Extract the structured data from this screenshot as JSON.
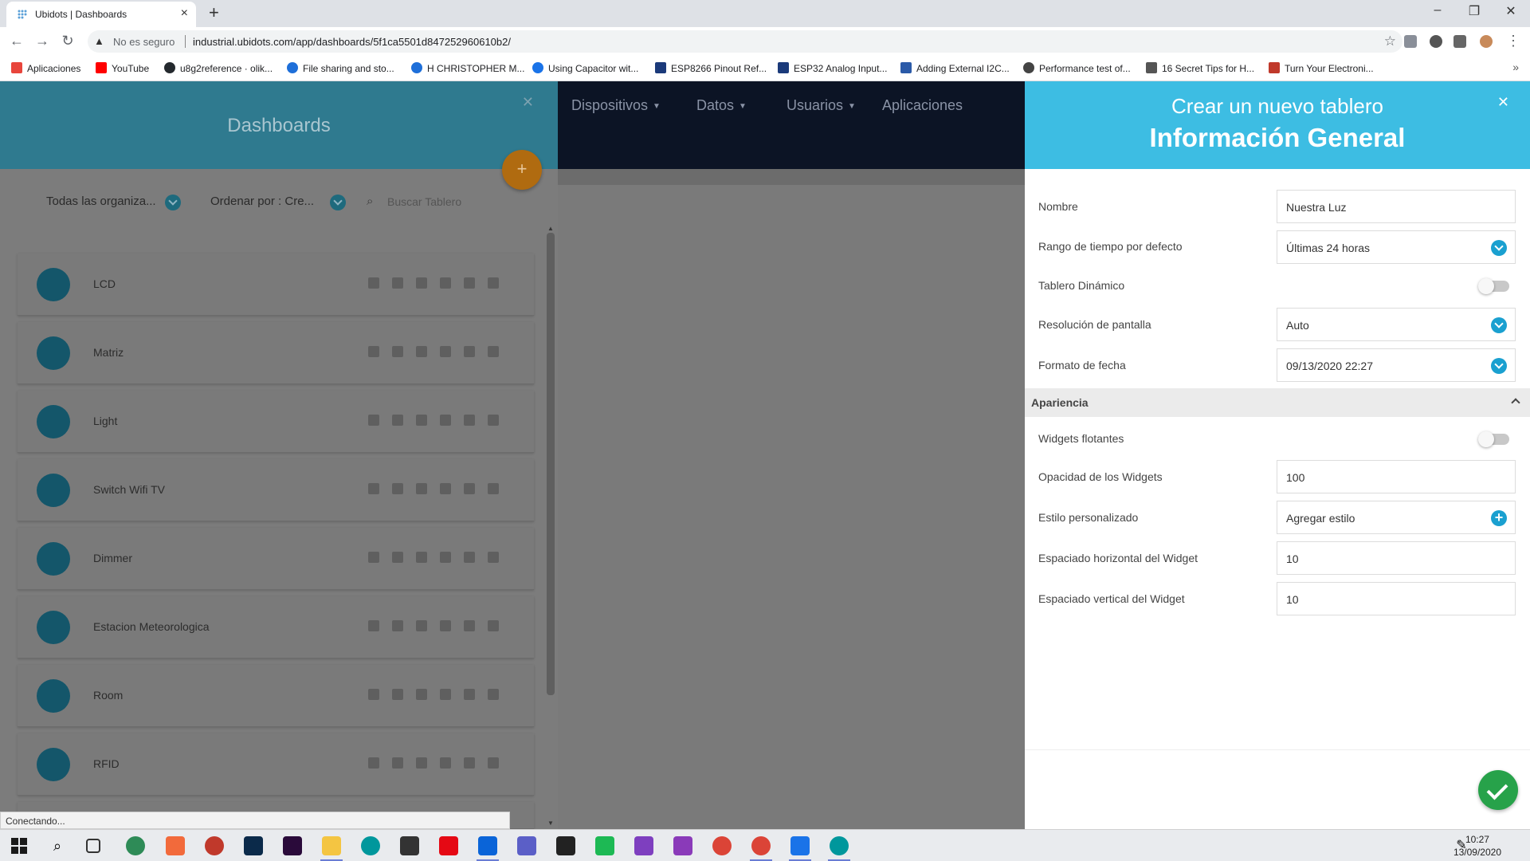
{
  "browser": {
    "tab_title": "Ubidots | Dashboards",
    "insecure_label": "No es seguro",
    "url": "industrial.ubidots.com/app/dashboards/5f1ca5501d847252960610b2/",
    "bookmarks": [
      {
        "label": "Aplicaciones",
        "color": "#e8453c"
      },
      {
        "label": "YouTube",
        "color": "#ff0000"
      },
      {
        "label": "u8g2reference · olik...",
        "color": "#24292e"
      },
      {
        "label": "File sharing and sto...",
        "color": "#1e6fd9"
      },
      {
        "label": "H CHRISTOPHER M...",
        "color": "#1e6fd9"
      },
      {
        "label": "Using Capacitor wit...",
        "color": "#1a73e8"
      },
      {
        "label": "ESP8266 Pinout Ref...",
        "color": "#1b3a7a"
      },
      {
        "label": "ESP32 Analog Input...",
        "color": "#1b3a7a"
      },
      {
        "label": "Adding External I2C...",
        "color": "#2b5aa8"
      },
      {
        "label": "Performance test of...",
        "color": "#444444"
      },
      {
        "label": "16 Secret Tips for H...",
        "color": "#555555"
      },
      {
        "label": "Turn Your Electroni...",
        "color": "#c0392b"
      }
    ]
  },
  "left_panel": {
    "title": "Dashboards",
    "add_label": "+",
    "filter_org": "Todas las organiza...",
    "filter_sort": "Ordenar por : Cre...",
    "search_placeholder": "Buscar Tablero",
    "dashboards": [
      "LCD",
      "Matriz",
      "Light",
      "Switch Wifi TV",
      "Dimmer",
      "Estacion Meteorologica",
      "Room",
      "RFID"
    ]
  },
  "top_nav": {
    "items": [
      "Dispositivos",
      "Datos",
      "Usuarios",
      "Aplicaciones"
    ]
  },
  "right_panel": {
    "title": "Crear un nuevo tablero",
    "subtitle": "Información General",
    "fields": {
      "name_label": "Nombre",
      "name_value": "Nuestra Luz",
      "time_range_label": "Rango de tiempo por defecto",
      "time_range_value": "Últimas 24 horas",
      "dynamic_label": "Tablero Dinámico",
      "dynamic_on": false,
      "resolution_label": "Resolución de pantalla",
      "resolution_value": "Auto",
      "date_format_label": "Formato de fecha",
      "date_format_value": "09/13/2020 22:27"
    },
    "appearance": {
      "section_title": "Apariencia",
      "floating_label": "Widgets flotantes",
      "floating_on": false,
      "opacity_label": "Opacidad de los Widgets",
      "opacity_value": "100",
      "custom_style_label": "Estilo personalizado",
      "custom_style_value": "Agregar estilo",
      "h_spacing_label": "Espaciado horizontal del Widget",
      "h_spacing_value": "10",
      "v_spacing_label": "Espaciado vertical del Widget",
      "v_spacing_value": "10"
    }
  },
  "status_text": "Conectando...",
  "taskbar": {
    "time": "10:27",
    "date": "13/09/2020"
  },
  "colors": {
    "header_accent": "#3dbde3",
    "confirm": "#27a24a",
    "add_fab": "#b06b10"
  }
}
